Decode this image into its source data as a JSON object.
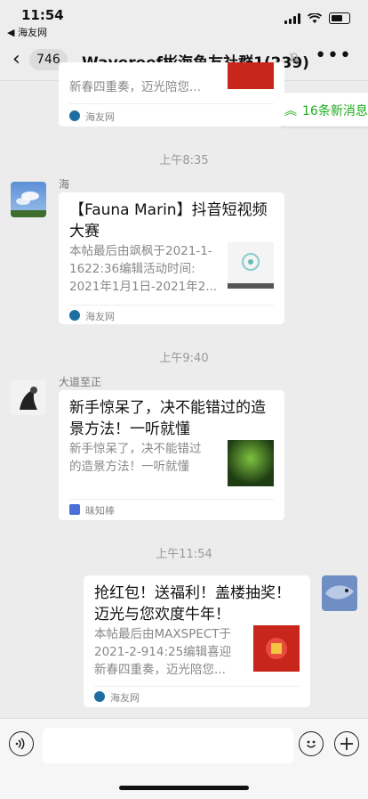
{
  "status_bar": {
    "time": "11:54",
    "back_app": "◀ 海友网"
  },
  "nav": {
    "unread_count": "746",
    "title": "Wavereef彬海鱼友社群1(239)"
  },
  "new_messages_chip": {
    "label": "16条新消息"
  },
  "messages": [
    {
      "card": {
        "desc_line": "新春四重奏，迈光陪您...",
        "source": "海友网"
      }
    },
    {
      "timestamp": "上午8:35",
      "sender": "海",
      "card": {
        "title_lines": [
          "【Fauna Marin】抖音短视频",
          "大赛"
        ],
        "desc_lines": [
          "本帖最后由飒枫于2021-1-",
          "1622:36编辑活动时间:",
          "2021年1月1日-2021年2..."
        ],
        "source": "海友网"
      }
    },
    {
      "timestamp": "上午9:40",
      "sender": "大道至正",
      "card": {
        "title_lines": [
          "新手惊呆了，决不能错过的造",
          "景方法！一听就懂"
        ],
        "desc_lines": [
          "新手惊呆了，决不能错过",
          "的造景方法！一听就懂"
        ],
        "source": "昧知棒"
      }
    },
    {
      "timestamp": "上午11:54",
      "card": {
        "title_lines": [
          "抢红包！送福利！盖楼抽奖！",
          "迈光与您欢度牛年！"
        ],
        "desc_lines": [
          "本帖最后由MAXSPECT于",
          "2021-2-914:25编辑喜迎",
          "新春四重奏，迈光陪您..."
        ],
        "source": "海友网"
      }
    }
  ],
  "input_bar": {
    "voice_icon": "voice-icon",
    "emoji_icon": "emoji-icon",
    "plus_icon": "plus-icon"
  }
}
